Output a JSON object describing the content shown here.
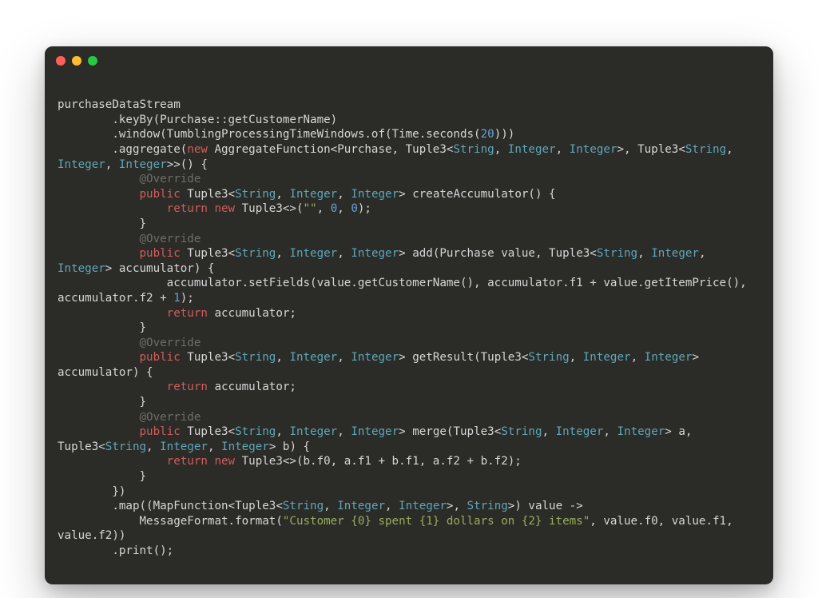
{
  "window": {
    "close_label": "close",
    "min_label": "minimize",
    "max_label": "zoom"
  },
  "colors": {
    "keyword": "#d15c5c",
    "type": "#5fa7b8",
    "number": "#6aa0d8",
    "string": "#9aad5a",
    "annotation": "#6e6e67",
    "text": "#d6d6d6",
    "background": "#2b2b28"
  },
  "code": {
    "tokens": [
      {
        "t": "purchaseDataStream"
      },
      {
        "t": "\n        .keyBy(Purchase::getCustomerName)"
      },
      {
        "t": "\n        .window(TumblingProcessingTimeWindows.of(Time.seconds("
      },
      {
        "t": "20",
        "c": "num"
      },
      {
        "t": ")))"
      },
      {
        "t": "\n        .aggregate("
      },
      {
        "t": "new",
        "c": "kw"
      },
      {
        "t": " AggregateFunction<Purchase, Tuple3<"
      },
      {
        "t": "String",
        "c": "ty"
      },
      {
        "t": ", "
      },
      {
        "t": "Integer",
        "c": "ty"
      },
      {
        "t": ", "
      },
      {
        "t": "Integer",
        "c": "ty"
      },
      {
        "t": ">, Tuple3<"
      },
      {
        "t": "String",
        "c": "ty"
      },
      {
        "t": ", "
      },
      {
        "t": "Integer",
        "c": "ty"
      },
      {
        "t": ", "
      },
      {
        "t": "Integer",
        "c": "ty"
      },
      {
        "t": ">>() {"
      },
      {
        "t": "\n            "
      },
      {
        "t": "@Override",
        "c": "an"
      },
      {
        "t": "\n            "
      },
      {
        "t": "public",
        "c": "kw"
      },
      {
        "t": " Tuple3<"
      },
      {
        "t": "String",
        "c": "ty"
      },
      {
        "t": ", "
      },
      {
        "t": "Integer",
        "c": "ty"
      },
      {
        "t": ", "
      },
      {
        "t": "Integer",
        "c": "ty"
      },
      {
        "t": "> createAccumulator() {"
      },
      {
        "t": "\n                "
      },
      {
        "t": "return",
        "c": "kw"
      },
      {
        "t": " "
      },
      {
        "t": "new",
        "c": "kw"
      },
      {
        "t": " Tuple3<>("
      },
      {
        "t": "\"\"",
        "c": "str"
      },
      {
        "t": ", "
      },
      {
        "t": "0",
        "c": "num"
      },
      {
        "t": ", "
      },
      {
        "t": "0",
        "c": "num"
      },
      {
        "t": ");"
      },
      {
        "t": "\n            }"
      },
      {
        "t": "\n            "
      },
      {
        "t": "@Override",
        "c": "an"
      },
      {
        "t": "\n            "
      },
      {
        "t": "public",
        "c": "kw"
      },
      {
        "t": " Tuple3<"
      },
      {
        "t": "String",
        "c": "ty"
      },
      {
        "t": ", "
      },
      {
        "t": "Integer",
        "c": "ty"
      },
      {
        "t": ", "
      },
      {
        "t": "Integer",
        "c": "ty"
      },
      {
        "t": "> add(Purchase value, Tuple3<"
      },
      {
        "t": "String",
        "c": "ty"
      },
      {
        "t": ", "
      },
      {
        "t": "Integer",
        "c": "ty"
      },
      {
        "t": ", "
      },
      {
        "t": "Integer",
        "c": "ty"
      },
      {
        "t": "> accumulator) {"
      },
      {
        "t": "\n                accumulator.setFields(value.getCustomerName(), accumulator.f1 + value.getItemPrice(), accumulator.f2 + "
      },
      {
        "t": "1",
        "c": "num"
      },
      {
        "t": ");"
      },
      {
        "t": "\n                "
      },
      {
        "t": "return",
        "c": "kw"
      },
      {
        "t": " accumulator;"
      },
      {
        "t": "\n            }"
      },
      {
        "t": "\n            "
      },
      {
        "t": "@Override",
        "c": "an"
      },
      {
        "t": "\n            "
      },
      {
        "t": "public",
        "c": "kw"
      },
      {
        "t": " Tuple3<"
      },
      {
        "t": "String",
        "c": "ty"
      },
      {
        "t": ", "
      },
      {
        "t": "Integer",
        "c": "ty"
      },
      {
        "t": ", "
      },
      {
        "t": "Integer",
        "c": "ty"
      },
      {
        "t": "> getResult(Tuple3<"
      },
      {
        "t": "String",
        "c": "ty"
      },
      {
        "t": ", "
      },
      {
        "t": "Integer",
        "c": "ty"
      },
      {
        "t": ", "
      },
      {
        "t": "Integer",
        "c": "ty"
      },
      {
        "t": "> accumulator) {"
      },
      {
        "t": "\n                "
      },
      {
        "t": "return",
        "c": "kw"
      },
      {
        "t": " accumulator;"
      },
      {
        "t": "\n            }"
      },
      {
        "t": "\n            "
      },
      {
        "t": "@Override",
        "c": "an"
      },
      {
        "t": "\n            "
      },
      {
        "t": "public",
        "c": "kw"
      },
      {
        "t": " Tuple3<"
      },
      {
        "t": "String",
        "c": "ty"
      },
      {
        "t": ", "
      },
      {
        "t": "Integer",
        "c": "ty"
      },
      {
        "t": ", "
      },
      {
        "t": "Integer",
        "c": "ty"
      },
      {
        "t": "> merge(Tuple3<"
      },
      {
        "t": "String",
        "c": "ty"
      },
      {
        "t": ", "
      },
      {
        "t": "Integer",
        "c": "ty"
      },
      {
        "t": ", "
      },
      {
        "t": "Integer",
        "c": "ty"
      },
      {
        "t": "> a, Tuple3<"
      },
      {
        "t": "String",
        "c": "ty"
      },
      {
        "t": ", "
      },
      {
        "t": "Integer",
        "c": "ty"
      },
      {
        "t": ", "
      },
      {
        "t": "Integer",
        "c": "ty"
      },
      {
        "t": "> b) {"
      },
      {
        "t": "\n                "
      },
      {
        "t": "return",
        "c": "kw"
      },
      {
        "t": " "
      },
      {
        "t": "new",
        "c": "kw"
      },
      {
        "t": " Tuple3<>(b.f0, a.f1 + b.f1, a.f2 + b.f2);"
      },
      {
        "t": "\n            }"
      },
      {
        "t": "\n        })"
      },
      {
        "t": "\n        .map((MapFunction<Tuple3<"
      },
      {
        "t": "String",
        "c": "ty"
      },
      {
        "t": ", "
      },
      {
        "t": "Integer",
        "c": "ty"
      },
      {
        "t": ", "
      },
      {
        "t": "Integer",
        "c": "ty"
      },
      {
        "t": ">, "
      },
      {
        "t": "String",
        "c": "ty"
      },
      {
        "t": ">) value ->"
      },
      {
        "t": "\n            MessageFormat.format("
      },
      {
        "t": "\"Customer {0} spent {1} dollars on {2} items\"",
        "c": "str"
      },
      {
        "t": ", value.f0, value.f1, value.f2))"
      },
      {
        "t": "\n        .print();"
      }
    ]
  }
}
